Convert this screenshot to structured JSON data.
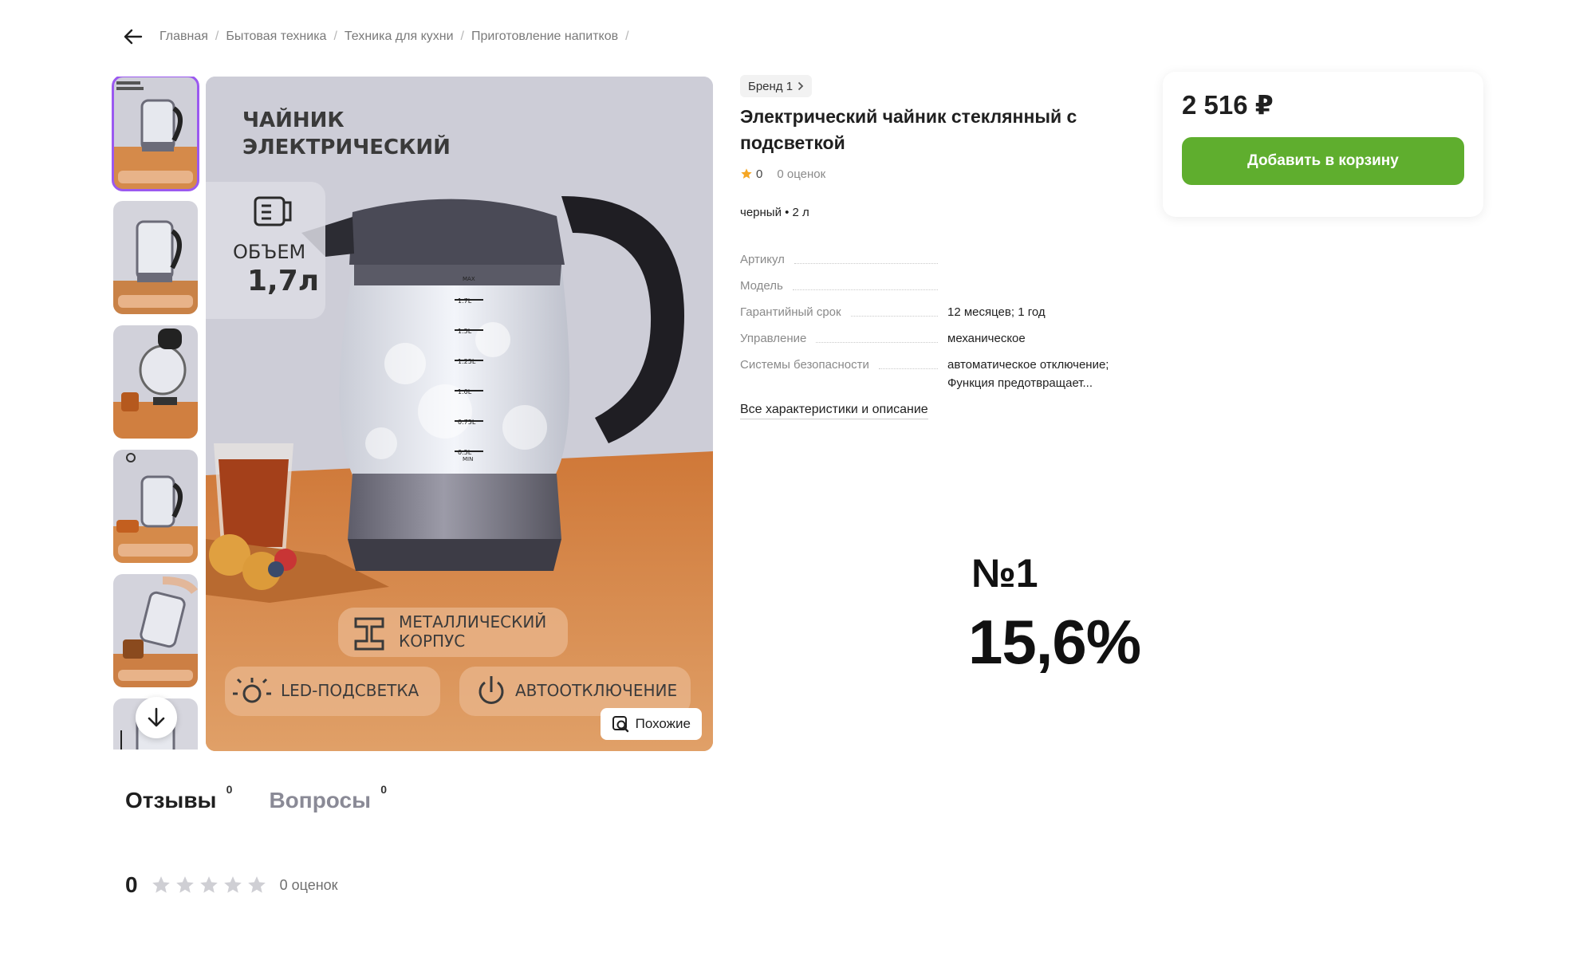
{
  "breadcrumbs": [
    "Главная",
    "Бытовая техника",
    "Техника для кухни",
    "Приготовление напитков"
  ],
  "gallery": {
    "main_image": {
      "title_line1": "ЧАЙНИК",
      "title_line2": "ЭЛЕКТРИЧЕСКИЙ",
      "volume_label": "ОБЪЕМ",
      "volume_value": "1,7л",
      "badge_metal_line1": "МЕТАЛЛИЧЕСКИЙ",
      "badge_metal_line2": "КОРПУС",
      "badge_led": "LED-ПОДСВЕТКА",
      "badge_auto": "АВТООТКЛЮЧЕНИЕ",
      "scale_marks": [
        "MAX",
        "1.7L",
        "1.5L",
        "1.25L",
        "1.0L",
        "0.75L",
        "0.5L",
        "MIN"
      ]
    },
    "similar_label": "Похожие"
  },
  "product": {
    "brand": "Бренд 1",
    "title": "Электрический чайник стеклянный с подсветкой",
    "rating": "0",
    "rating_count": "0 оценок",
    "variant": "черный • 2 л",
    "specs": [
      {
        "name": "Артикул",
        "value": ""
      },
      {
        "name": "Модель",
        "value": ""
      },
      {
        "name": "Гарантийный срок",
        "value": "12 месяцев; 1 год"
      },
      {
        "name": "Управление",
        "value": "механическое"
      },
      {
        "name": "Системы безопасности",
        "value": "автоматическое отключение; Функция предотвращает..."
      }
    ],
    "all_specs_link": "Все характеристики и описание"
  },
  "buy_box": {
    "price": "2 516 ₽",
    "add_to_cart": "Добавить в корзину"
  },
  "promo": {
    "rank": "№1",
    "percent": "15,6%"
  },
  "tabs": [
    {
      "label": "Отзывы",
      "count": "0"
    },
    {
      "label": "Вопросы",
      "count": "0"
    }
  ],
  "reviews": {
    "score": "0",
    "count": "0 оценок",
    "stars_filled": 0
  },
  "colors": {
    "accent_green": "#5fae2e",
    "thumb_active": "#9b59f0",
    "star_orange": "#f5a623"
  }
}
